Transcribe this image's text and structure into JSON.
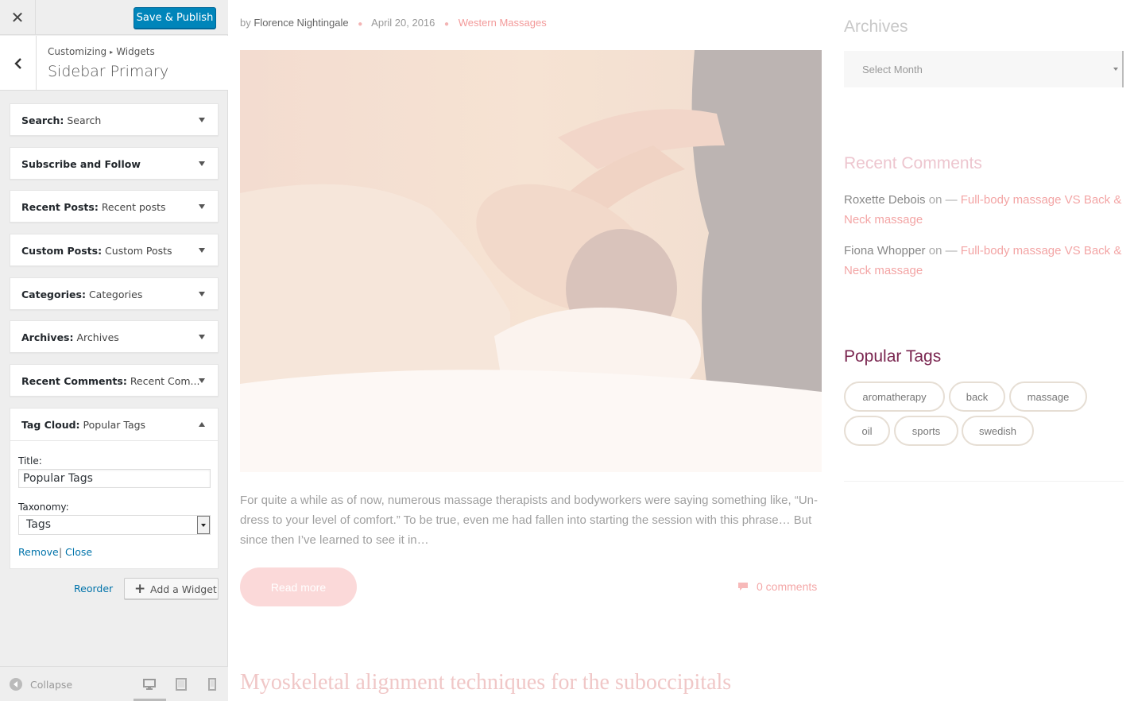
{
  "customizer": {
    "close_icon": "close-icon",
    "save_label": "Save & Publish",
    "save_color": "#0085ba",
    "breadcrumb": {
      "root": "Customizing",
      "leaf": "Widgets"
    },
    "section_title": "Sidebar Primary",
    "widgets": [
      {
        "name": "Search",
        "title": "Search"
      },
      {
        "name": "Subscribe and Follow",
        "title": ""
      },
      {
        "name": "Recent Posts",
        "title": "Recent posts"
      },
      {
        "name": "Custom Posts",
        "title": "Custom Posts"
      },
      {
        "name": "Categories",
        "title": "Categories"
      },
      {
        "name": "Archives",
        "title": "Archives"
      },
      {
        "name": "Recent Comments",
        "title": "Recent Com..."
      }
    ],
    "tag_widget": {
      "name": "Tag Cloud",
      "title": "Popular Tags",
      "title_label": "Title:",
      "title_value": "Popular Tags",
      "taxonomy_label": "Taxonomy:",
      "taxonomy_value": "Tags",
      "remove_label": "Remove",
      "separator": "|",
      "close_label": "Close"
    },
    "reorder_label": "Reorder",
    "add_widget_label": "Add a Widget",
    "collapse_label": "Collapse",
    "devices": [
      "desktop-icon",
      "tablet-icon",
      "mobile-icon"
    ]
  },
  "preview": {
    "post": {
      "by": "by",
      "author": "Florence Nightingale",
      "date": "April 20, 2016",
      "category": "Western Massages",
      "excerpt": "For quite a while as of now, numerous massage therapists and bodyworkers were saying something like, “Un-dress to your level of comfort.” To be true, even me had fallen into starting the session with this phrase… But since then I’ve learned to see it in…",
      "read_more": "Read more",
      "comments": "0 comments",
      "next_title": "Myoskeletal alignment techniques for the suboccipitals"
    },
    "sidebar": {
      "archives_heading": "Archives",
      "archives_select": "Select Month",
      "recent_comments_heading": "Recent Comments",
      "comments": [
        {
          "author": "Roxette Debois",
          "on": "on",
          "dash": "—",
          "link": "Full-body massage VS Back & Neck massage"
        },
        {
          "author": "Fiona Whopper",
          "on": "on",
          "dash": "—",
          "link": "Full-body massage VS Back & Neck massage"
        }
      ],
      "popular_tags_heading": "Popular Tags",
      "popular_tags_color": "#7a2650",
      "tags": [
        "aromatherapy",
        "back",
        "massage",
        "oil",
        "sports",
        "swedish"
      ]
    }
  }
}
